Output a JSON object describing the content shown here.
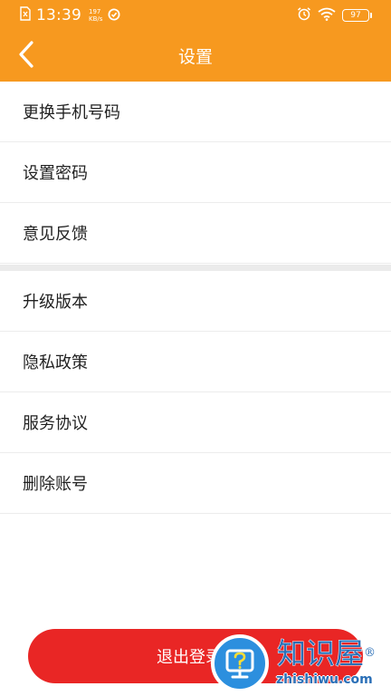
{
  "status_bar": {
    "time": "13:39",
    "speed_value": "197",
    "speed_unit": "KB/s",
    "battery": "97"
  },
  "nav": {
    "title": "设置"
  },
  "menu": {
    "group1": [
      {
        "label": "更换手机号码"
      },
      {
        "label": "设置密码"
      },
      {
        "label": "意见反馈"
      }
    ],
    "group2": [
      {
        "label": "升级版本"
      },
      {
        "label": "隐私政策"
      },
      {
        "label": "服务协议"
      },
      {
        "label": "删除账号"
      }
    ]
  },
  "logout": {
    "label": "退出登录"
  },
  "watermark": {
    "brand": "知识屋",
    "registered": "®",
    "domain": "zhishiwu.com"
  },
  "colors": {
    "header": "#f7991f",
    "logout": "#e92625",
    "watermark": "#2a6fb7"
  },
  "icons": {
    "back": "chevron-left-icon",
    "alarm": "alarm-icon",
    "wifi": "wifi-icon",
    "battery": "battery-icon",
    "sim": "sim-card-icon",
    "sync": "sync-icon"
  }
}
